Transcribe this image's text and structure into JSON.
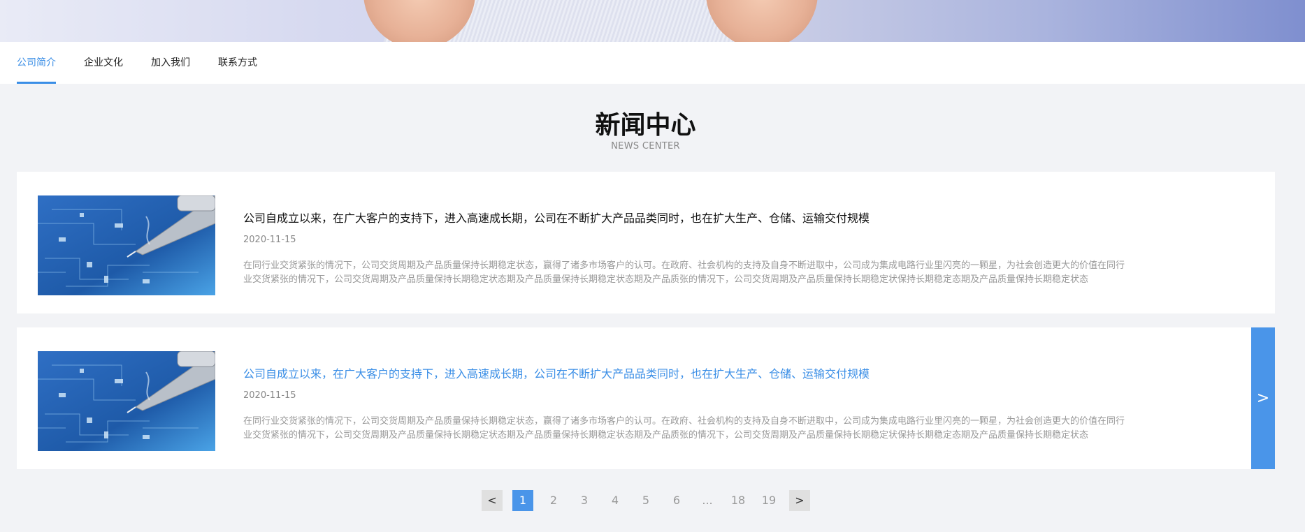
{
  "tabs": [
    {
      "label": "公司简介",
      "active": true
    },
    {
      "label": "企业文化",
      "active": false
    },
    {
      "label": "加入我们",
      "active": false
    },
    {
      "label": "联系方式",
      "active": false
    }
  ],
  "section": {
    "title": "新闻中心",
    "subtitle": "NEWS CENTER"
  },
  "news": [
    {
      "title": "公司自成立以来，在广大客户的支持下，进入高速成长期，公司在不断扩大产品品类同时，也在扩大生产、仓储、运输交付规模",
      "date": "2020-11-15",
      "summary": "在同行业交货紧张的情况下，公司交货周期及产品质量保持长期稳定状态，赢得了诸多市场客户的认可。在政府、社会机构的支持及自身不断进取中，公司成为集成电路行业里闪亮的一颗星，为社会创造更大的价值在同行业交货紧张的情况下，公司交货周期及产品质量保持长期稳定状态期及产品质量保持长期稳定状态期及产品质张的情况下，公司交货周期及产品质量保持长期稳定状保持长期稳定态期及产品质量保持长期稳定状态"
    },
    {
      "title": "公司自成立以来，在广大客户的支持下，进入高速成长期，公司在不断扩大产品品类同时，也在扩大生产、仓储、运输交付规模",
      "date": "2020-11-15",
      "summary": "在同行业交货紧张的情况下，公司交货周期及产品质量保持长期稳定状态，赢得了诸多市场客户的认可。在政府、社会机构的支持及自身不断进取中，公司成为集成电路行业里闪亮的一颗星，为社会创造更大的价值在同行业交货紧张的情况下，公司交货周期及产品质量保持长期稳定状态期及产品质量保持长期稳定状态期及产品质张的情况下，公司交货周期及产品质量保持长期稳定状保持长期稳定态期及产品质量保持长期稳定状态"
    }
  ],
  "detail_arrow": ">",
  "pagination": {
    "prev": "<",
    "next": ">",
    "pages": [
      "1",
      "2",
      "3",
      "4",
      "5",
      "6",
      "...",
      "18",
      "19"
    ],
    "current": "1"
  },
  "colors": {
    "accent": "#3a8ee6",
    "button": "#4a95e9",
    "background": "#f2f3f6"
  }
}
